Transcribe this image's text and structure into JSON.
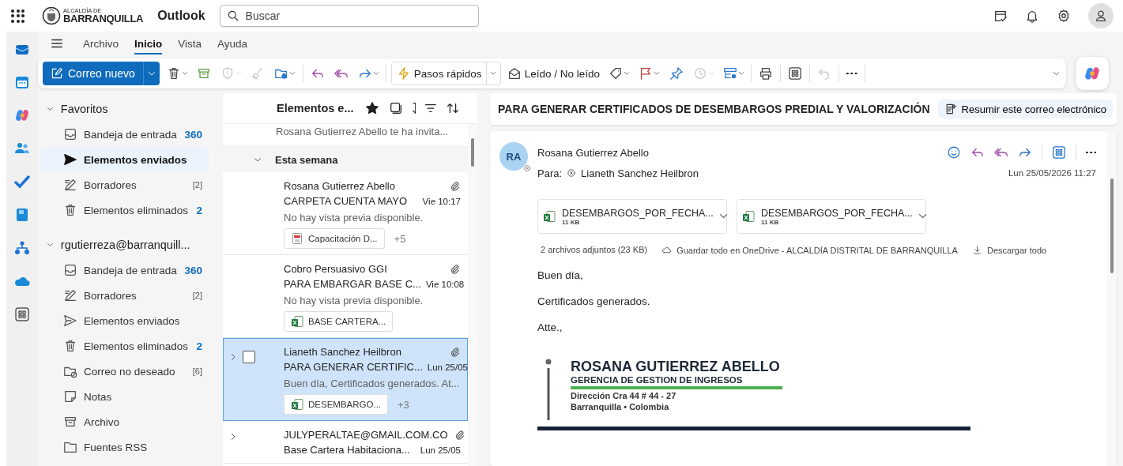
{
  "top_bar": {
    "logo_small": "ALCALDÍA DE",
    "logo_big": "BARRANQUILLA",
    "app_name": "Outlook",
    "search": {
      "placeholder": "Buscar"
    }
  },
  "ribbon_tabs": [
    {
      "label": "Archivo",
      "selected": false
    },
    {
      "label": "Inicio",
      "selected": true
    },
    {
      "label": "Vista",
      "selected": false
    },
    {
      "label": "Ayuda",
      "selected": false
    }
  ],
  "toolbar": [
    {
      "kind": "primary",
      "label": "Correo nuevo"
    },
    {
      "kind": "icon",
      "disabled": false
    },
    {
      "kind": "icon",
      "disabled": false
    },
    {
      "kind": "icon",
      "disabled": true
    },
    {
      "kind": "icon",
      "disabled": true
    },
    {
      "kind": "icon",
      "disabled": false
    },
    {
      "kind": "separator"
    },
    {
      "kind": "icon",
      "disabled": false
    },
    {
      "kind": "icon",
      "disabled": false
    },
    {
      "kind": "icon",
      "disabled": false
    },
    {
      "kind": "separator"
    },
    {
      "kind": "split",
      "label": "Pasos rápidos"
    },
    {
      "kind": "text",
      "label": "Leído / No leído"
    },
    {
      "kind": "icon",
      "disabled": false
    },
    {
      "kind": "icon",
      "disabled": false
    },
    {
      "kind": "icon",
      "disabled": false
    },
    {
      "kind": "icon",
      "disabled": true
    },
    {
      "kind": "icon",
      "disabled": false
    },
    {
      "kind": "separator"
    },
    {
      "kind": "icon",
      "disabled": false
    },
    {
      "kind": "separator"
    },
    {
      "kind": "icon",
      "disabled": false
    },
    {
      "kind": "separator"
    },
    {
      "kind": "icon",
      "disabled": true
    },
    {
      "kind": "separator"
    },
    {
      "kind": "icon",
      "disabled": false
    },
    {
      "kind": "separator"
    }
  ],
  "folder_groups": [
    {
      "label": "Favoritos",
      "expanded": true,
      "items": [
        {
          "label": "Bandeja de entrada",
          "count": "360",
          "unread": true,
          "selected": false
        },
        {
          "label": "Elementos enviados",
          "selected": true
        },
        {
          "label": "Borradores",
          "count": "[2]",
          "unread": false,
          "selected": false
        },
        {
          "label": "Elementos eliminados",
          "count": "2",
          "unread": true,
          "selected": false
        }
      ]
    },
    {
      "label": "rgutierreza@barranquill...",
      "expanded": true,
      "items": [
        {
          "label": "Bandeja de entrada",
          "count": "360",
          "unread": true,
          "selected": false
        },
        {
          "label": "Borradores",
          "count": "[2]",
          "unread": false,
          "selected": false
        },
        {
          "label": "Elementos enviados",
          "selected": false
        },
        {
          "label": "Elementos eliminados",
          "count": "2",
          "unread": true,
          "selected": false
        },
        {
          "label": "Correo no deseado",
          "count": "[6]",
          "unread": false,
          "selected": false
        },
        {
          "label": "Notas",
          "selected": false
        },
        {
          "label": "Archivo",
          "selected": false
        },
        {
          "label": "Fuentes RSS",
          "selected": false
        }
      ]
    }
  ],
  "message_list": {
    "title": "Elementos e...",
    "top_preview": "Rosana Gutierrez Abello te ha invita...",
    "group": {
      "label": "Esta semana",
      "expanded": true
    },
    "messages": [
      {
        "sender": "Rosana Gutierrez Abello",
        "subject": "CARPETA CUENTA MAYO",
        "time": "Vie 10:17",
        "preview": "No hay vista previa disponible.",
        "attachment": {
          "name": "Capacitación D...",
          "kind": "pdf"
        },
        "more": "+5",
        "expandable": false,
        "selected": false
      },
      {
        "sender": "Cobro Persuasivo GGI",
        "subject": "PARA EMBARGAR BASE C...",
        "time": "Vie 10:08",
        "preview": "No hay vista previa disponible.",
        "attachment": {
          "name": "BASE CARTERA...",
          "kind": "excel"
        },
        "expandable": false,
        "selected": false
      },
      {
        "sender": "Lianeth Sanchez Heilbron",
        "subject": "PARA GENERAR CERTIFIC...",
        "time": "Lun 25/05",
        "preview": "Buen día, Certificados generados. At...",
        "attachment": {
          "name": "DESEMBARGO...",
          "kind": "excel"
        },
        "more": "+3",
        "expandable": true,
        "selected": true
      },
      {
        "sender": "JULYPERALTAE@GMAIL.COM.CO",
        "subject": "Base Cartera Habitaciona...",
        "time": "Lun 25/05",
        "expandable": true,
        "selected": false
      }
    ]
  },
  "reading_pane": {
    "subject": "PARA GENERAR CERTIFICADOS DE DESEMBARGOS PREDIAL Y VALORIZACIÓN",
    "summarize": "Resumir este correo electrónico",
    "sender": "Rosana Gutierrez Abello",
    "initials": "RA",
    "to_label": "Para:",
    "recipient": "Lianeth Sanchez Heilbron",
    "date": "Lun 25/05/2026 11:27",
    "attachments": [
      {
        "name": "DESEMBARGOS_POR_FECHA...",
        "size": "11 KB",
        "kind": "excel"
      },
      {
        "name": "DESEMBARGOS_POR_FECHA...",
        "size": "11 KB",
        "kind": "excel"
      }
    ],
    "attachments_summary": "2 archivos adjuntos (23 KB)",
    "save_all": "Guardar todo en OneDrive - ALCALDÍA DISTRITAL DE BARRANQUILLA",
    "download_all": "Descargar todo",
    "body": [
      "Buen día,",
      "Certificados generados.",
      "Atte.,"
    ],
    "signature": {
      "name": "ROSANA GUTIERREZ ABELLO",
      "department": "GERENCIA DE GESTION DE INGRESOS",
      "address": "Dirección Cra 44 # 44 - 27",
      "city": "Barranquilla • Colombia"
    }
  }
}
